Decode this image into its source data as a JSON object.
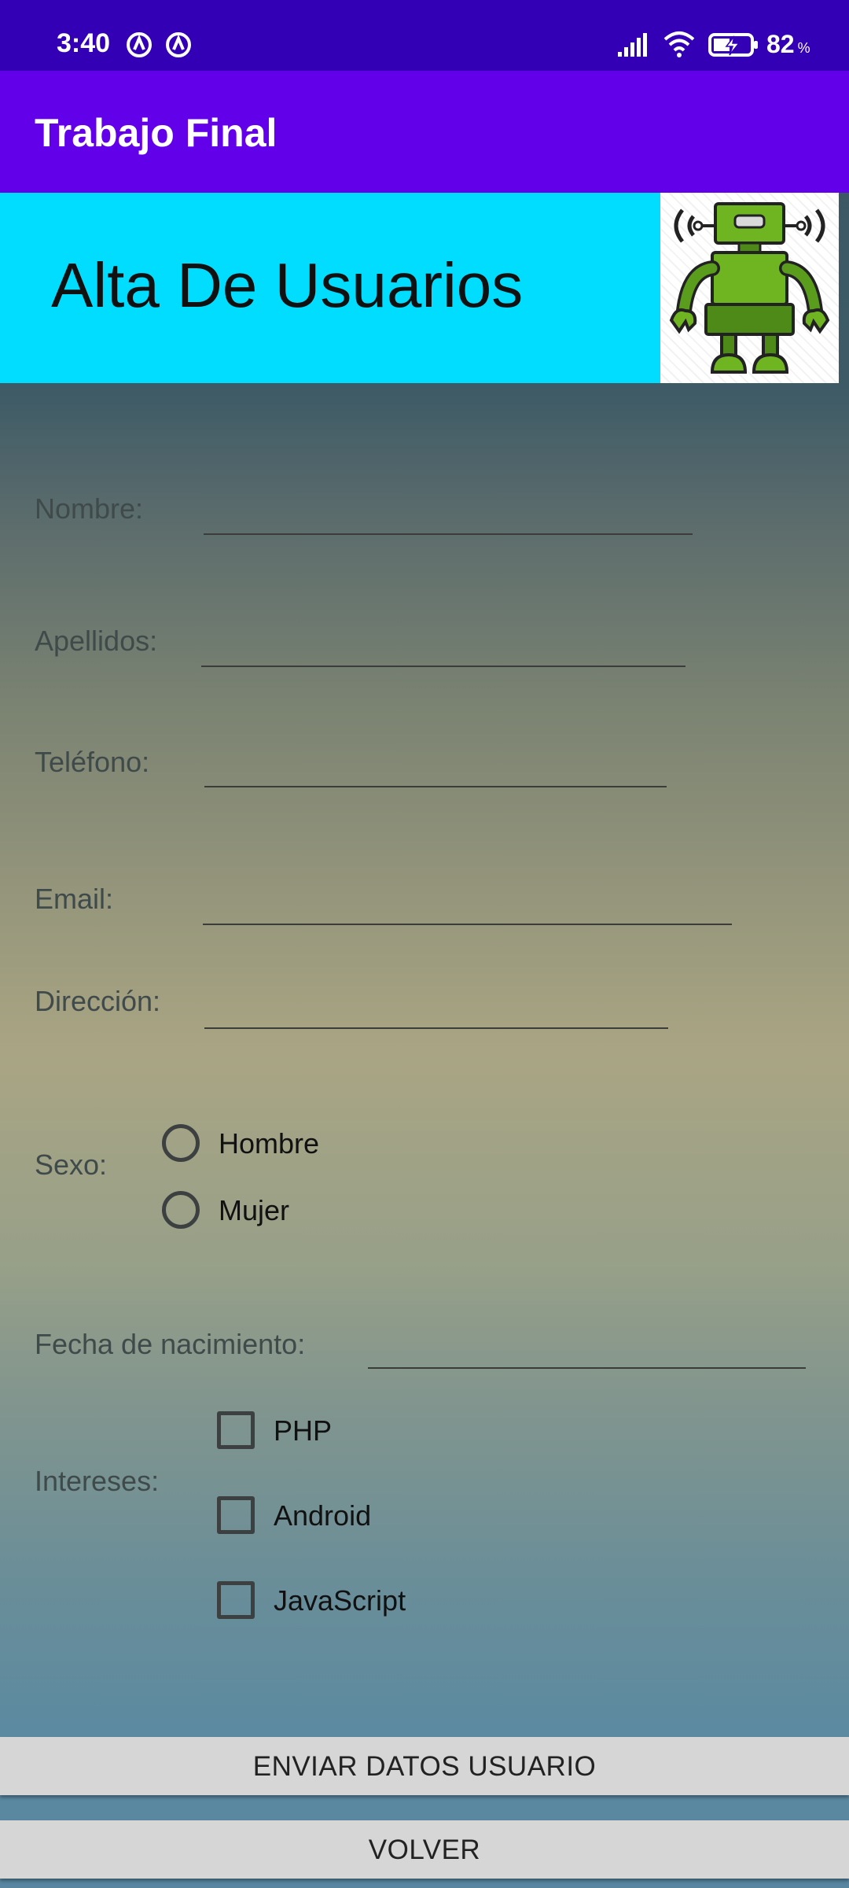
{
  "status_bar": {
    "time": "3:40",
    "battery_percent": "82",
    "battery_unit": "%",
    "icons": [
      "notification-icon",
      "notification-icon",
      "signal-icon",
      "wifi-icon",
      "battery-charging-icon"
    ]
  },
  "app_bar": {
    "title": "Trabajo Final"
  },
  "header": {
    "title": "Alta De Usuarios",
    "image_icon": "robot-icon"
  },
  "form": {
    "nombre_label": "Nombre:",
    "apellidos_label": "Apellidos:",
    "telefono_label": "Teléfono:",
    "email_label": "Email:",
    "direccion_label": "Dirección:",
    "sexo_label": "Sexo:",
    "sexo_options": [
      {
        "label": "Hombre",
        "checked": false
      },
      {
        "label": "Mujer",
        "checked": false
      }
    ],
    "fecha_label": "Fecha de nacimiento:",
    "intereses_label": "Intereses:",
    "intereses_options": [
      {
        "label": "PHP",
        "checked": false
      },
      {
        "label": "Android",
        "checked": false
      },
      {
        "label": "JavaScript",
        "checked": false
      }
    ]
  },
  "buttons": {
    "submit": "ENVIAR DATOS USUARIO",
    "back": "VOLVER"
  },
  "colors": {
    "status_bar": "#3300b5",
    "app_bar": "#6200ea",
    "banner": "#00ddff",
    "button": "#d6d6d6"
  }
}
